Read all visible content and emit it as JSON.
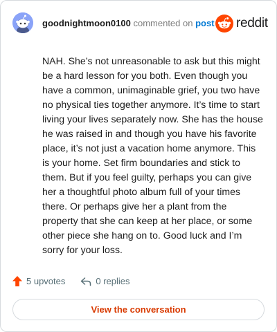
{
  "header": {
    "username": "goodnightmoon0100",
    "commented_on": "commented on",
    "post_link": "post",
    "brand_wordmark": "reddit"
  },
  "comment": {
    "body": "NAH. She’s not unreasonable to ask but this might be a hard lesson for you both. Even though you have a common, unimaginable grief, you two have no physical ties together anymore. It’s time to start living your lives separately now. She has the house he was raised in and though you have his favorite place, it’s not just a vacation home anymore. This is your home. Set firm boundaries and stick to them. But if you feel guilty, perhaps you can give her a thoughtful photo album full of your times there. Or perhaps give her a plant from the property that she can keep at her place, or some other piece she hang on to. Good luck and I’m sorry for your loss."
  },
  "actions": {
    "upvotes": "5 upvotes",
    "replies": "0 replies"
  },
  "footer": {
    "view_conversation": "View the conversation"
  },
  "icons": {
    "avatar": "snoo-avatar-icon",
    "brand": "reddit-logo-icon",
    "upvote": "upvote-arrow-icon",
    "reply": "reply-arrow-icon"
  },
  "colors": {
    "brand_orange": "#ff4500",
    "link_blue": "#0079d3",
    "button_text": "#d93a00",
    "avatar_bg": "#8aa3f8"
  }
}
